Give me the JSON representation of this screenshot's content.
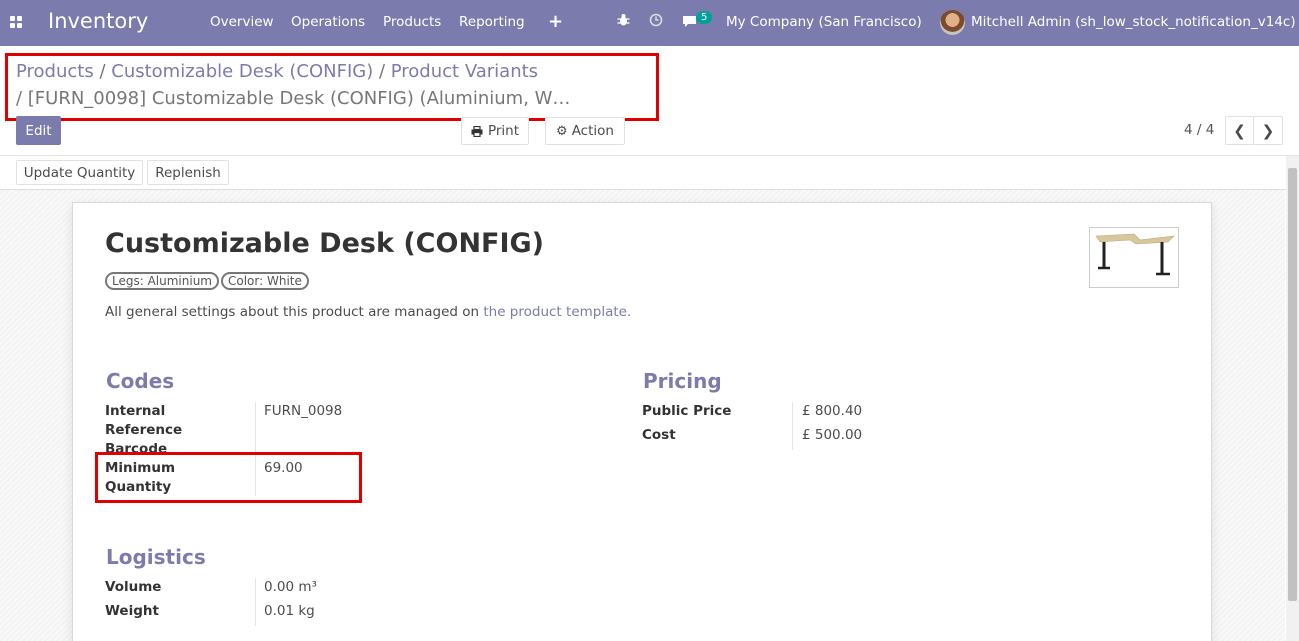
{
  "navbar": {
    "brand": "Inventory",
    "menu": [
      "Overview",
      "Operations",
      "Products",
      "Reporting"
    ],
    "plus": "+",
    "chat_count": "5",
    "company": "My Company (San Francisco)",
    "user": "Mitchell Admin (sh_low_stock_notification_v14c)"
  },
  "breadcrumb": {
    "items": [
      "Products",
      "Customizable Desk (CONFIG)",
      "Product Variants"
    ],
    "separator": " / ",
    "current": " / [FURN_0098] Customizable Desk (CONFIG) (Aluminium, W…"
  },
  "controls": {
    "edit": "Edit",
    "print": "Print",
    "action": "Action",
    "pager": "4 / 4"
  },
  "statusbar": {
    "update_quantity": "Update Quantity",
    "replenish": "Replenish"
  },
  "product": {
    "name": "Customizable Desk (CONFIG)",
    "tags": [
      "Legs: Aluminium",
      "Color: White"
    ],
    "info_text": "All general settings about this product are managed on ",
    "info_link": "the product template."
  },
  "codes": {
    "title": "Codes",
    "internal_ref_label": "Internal Reference",
    "internal_ref_value": "FURN_0098",
    "barcode_label": "Barcode",
    "min_qty_label": "Minimum Quantity",
    "min_qty_value": "69.00"
  },
  "pricing": {
    "title": "Pricing",
    "public_price_label": "Public Price",
    "public_price_value": "£ 800.40",
    "cost_label": "Cost",
    "cost_value": "£ 500.00"
  },
  "logistics": {
    "title": "Logistics",
    "volume_label": "Volume",
    "volume_value": "0.00 m³",
    "weight_label": "Weight",
    "weight_value": "0.01 kg"
  },
  "colors": {
    "brand": "#7c7bad",
    "highlight": "#e00000"
  }
}
